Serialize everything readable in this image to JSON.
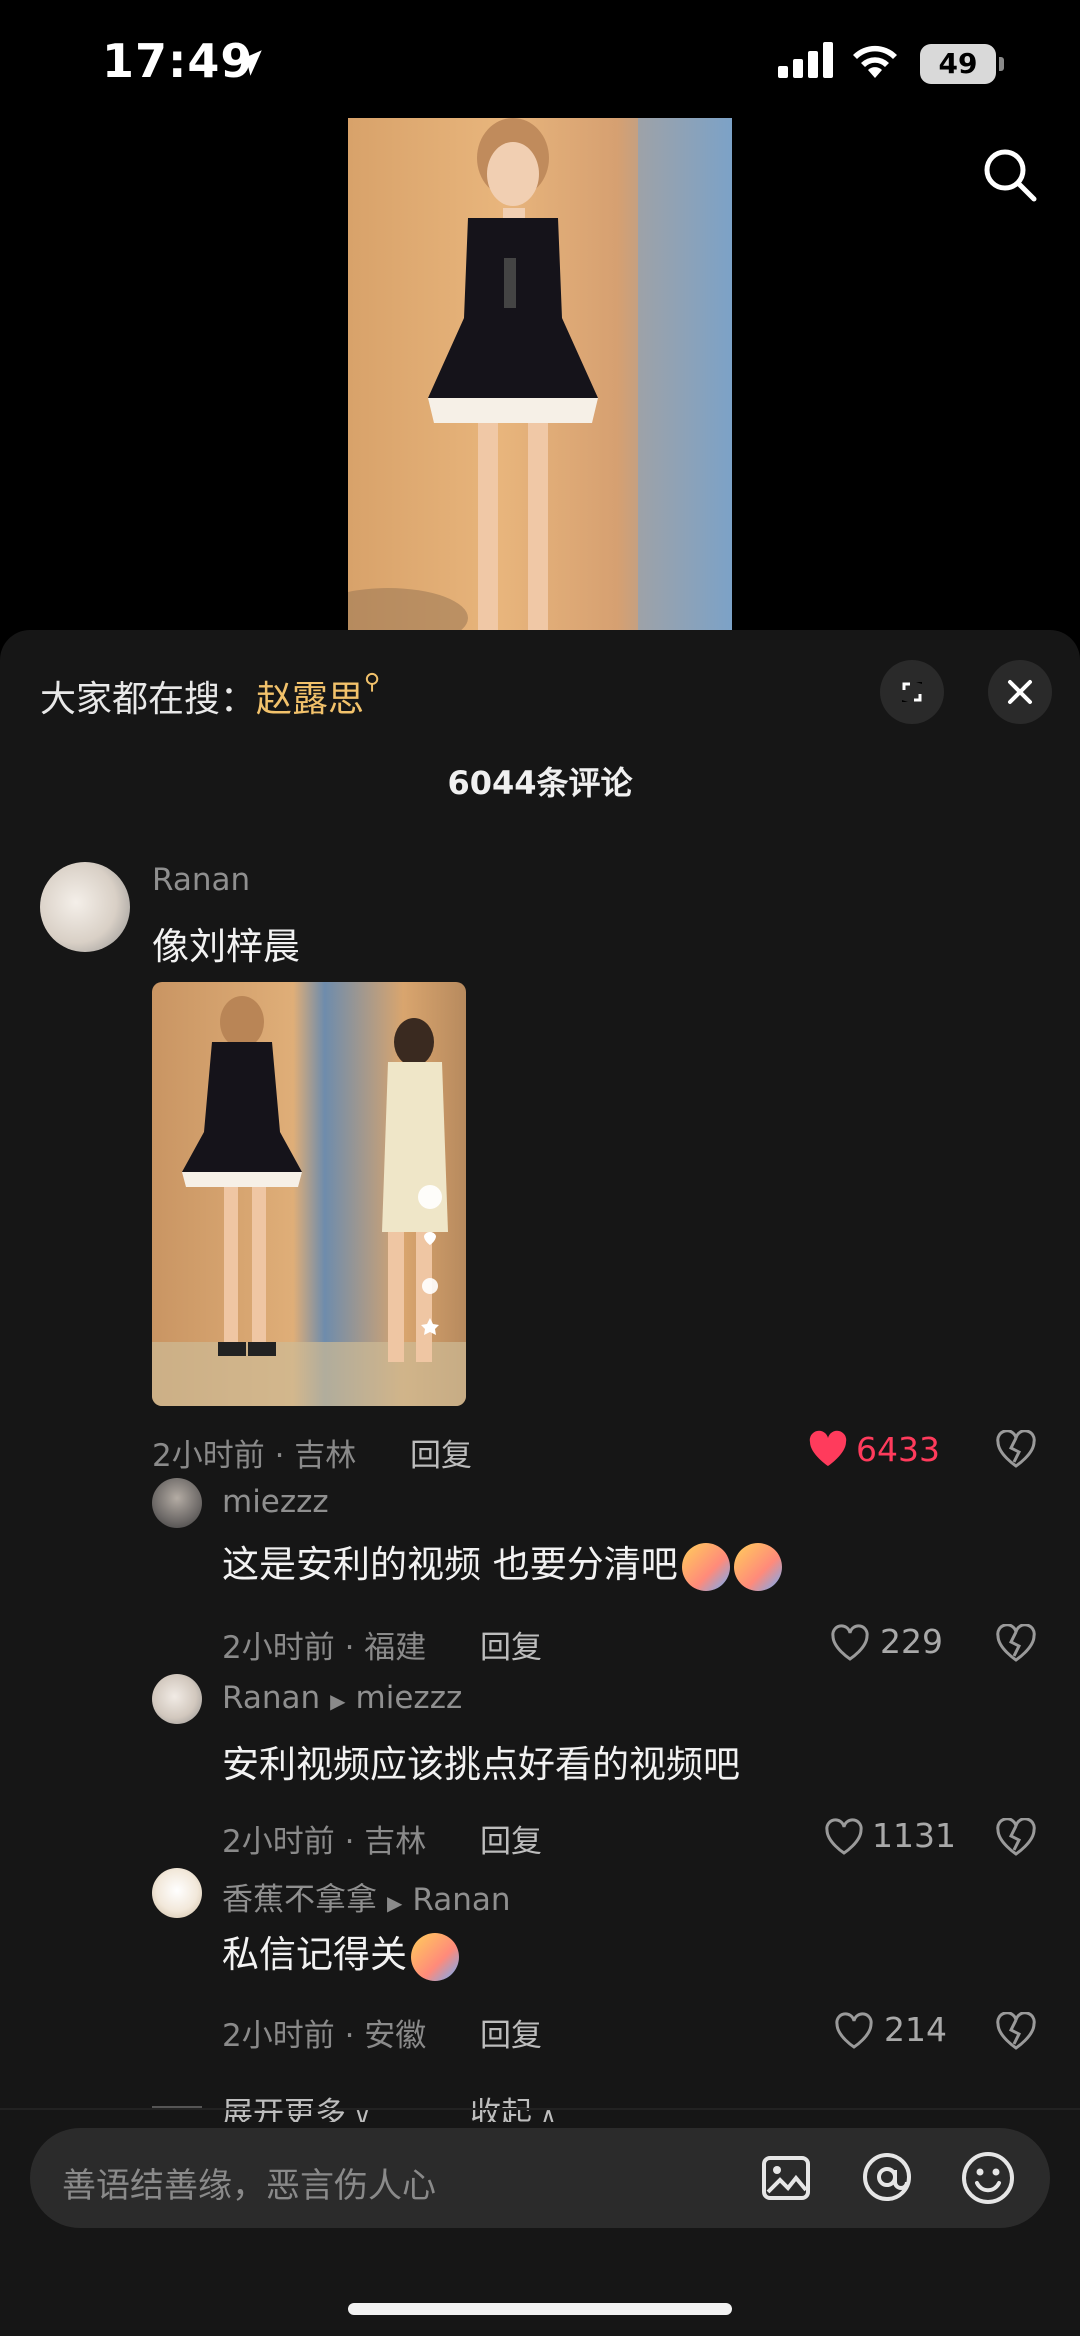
{
  "status_bar": {
    "time": "17:49",
    "battery": "49"
  },
  "panel": {
    "hot_search_label": "大家都在搜：",
    "hot_search_keyword": "赵露思",
    "comment_count": "6044条评论"
  },
  "comments": [
    {
      "user": "Ranan",
      "text": "像刘梓晨",
      "meta": "2小时前 · 吉林",
      "reply": "回复",
      "likes": "6433",
      "liked": true
    },
    {
      "user": "miezzz",
      "text": "这是安利的视频 也要分清吧",
      "meta": "2小时前 · 福建",
      "reply": "回复",
      "likes": "229"
    },
    {
      "user": "Ranan",
      "reply_to": "miezzz",
      "text": "安利视频应该挑点好看的视频吧",
      "meta": "2小时前 · 吉林",
      "reply": "回复",
      "likes": "1131"
    },
    {
      "user": "香蕉不拿拿",
      "reply_to": "Ranan",
      "text": "私信记得关",
      "meta": "2小时前 · 安徽",
      "reply": "回复",
      "likes": "214"
    }
  ],
  "thread_controls": {
    "expand_more": "展开更多",
    "collapse": "收起"
  },
  "input": {
    "placeholder": "善语结善缘，恶言伤人心"
  },
  "colors": {
    "accent_like": "#ff3b5c",
    "keyword": "#f2c26b",
    "panel_bg": "#161616"
  }
}
